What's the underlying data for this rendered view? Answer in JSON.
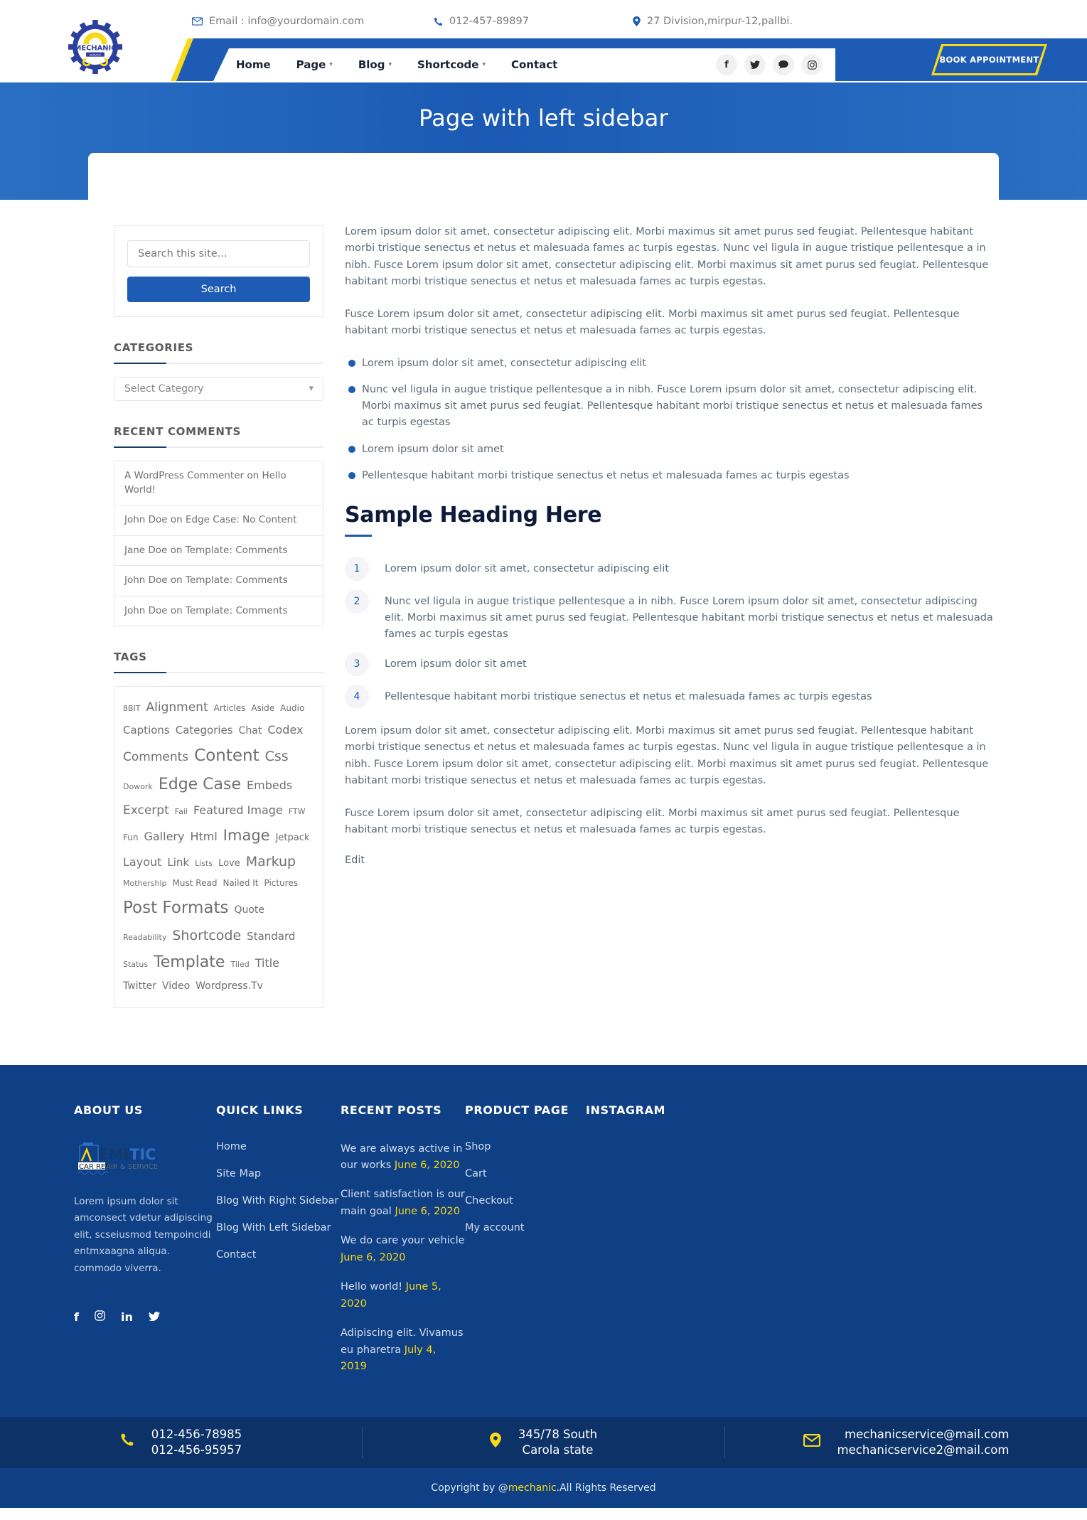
{
  "topbar": {
    "email": "Email : info@yourdomain.com",
    "phone": "012-457-89897",
    "address": "27 Division,mirpur-12,pallbi.",
    "email_icon": "envelope-icon",
    "phone_icon": "phone-icon",
    "address_icon": "map-pin-icon"
  },
  "logo": {
    "name": "MECHANIC",
    "sub": "SERVICE"
  },
  "nav": {
    "items": [
      {
        "label": "Home",
        "caret": false
      },
      {
        "label": "Page",
        "caret": true
      },
      {
        "label": "Blog",
        "caret": true
      },
      {
        "label": "Shortcode",
        "caret": true
      },
      {
        "label": "Contact",
        "caret": false
      }
    ],
    "social": [
      "facebook-icon",
      "twitter-icon",
      "comment-icon",
      "instagram-icon"
    ],
    "social_glyphs": [
      "f",
      "🐦",
      "💬",
      "▣"
    ],
    "book_button": "BOOK APPOINTMENT"
  },
  "banner": {
    "title": "Page with left sidebar"
  },
  "sidebar": {
    "search": {
      "placeholder": "Search this site...",
      "value": "",
      "button": "Search"
    },
    "categories": {
      "title": "CATEGORIES",
      "selected": "Select Category"
    },
    "recent_comments": {
      "title": "RECENT COMMENTS",
      "items": [
        "A WordPress Commenter on Hello World!",
        "John Doe on Edge Case: No Content",
        "Jane Doe on Template: Comments",
        "John Doe on Template: Comments",
        "John Doe on Template: Comments"
      ]
    },
    "tags": {
      "title": "TAGS",
      "items": [
        {
          "label": "8BIT",
          "size": 11
        },
        {
          "label": "Alignment",
          "size": 17
        },
        {
          "label": "Articles",
          "size": 12
        },
        {
          "label": "Aside",
          "size": 12
        },
        {
          "label": "Audio",
          "size": 12
        },
        {
          "label": "Captions",
          "size": 15
        },
        {
          "label": "Categories",
          "size": 15
        },
        {
          "label": "Chat",
          "size": 14
        },
        {
          "label": "Codex",
          "size": 16
        },
        {
          "label": "Comments",
          "size": 17
        },
        {
          "label": "Content",
          "size": 23
        },
        {
          "label": "Css",
          "size": 19
        },
        {
          "label": "Dowork",
          "size": 11
        },
        {
          "label": "Edge Case",
          "size": 22
        },
        {
          "label": "Embeds",
          "size": 16
        },
        {
          "label": "Excerpt",
          "size": 17
        },
        {
          "label": "Fail",
          "size": 11
        },
        {
          "label": "Featured Image",
          "size": 16
        },
        {
          "label": "FTW",
          "size": 11
        },
        {
          "label": "Fun",
          "size": 12
        },
        {
          "label": "Gallery",
          "size": 16
        },
        {
          "label": "Html",
          "size": 16
        },
        {
          "label": "Image",
          "size": 21
        },
        {
          "label": "Jetpack",
          "size": 13
        },
        {
          "label": "Layout",
          "size": 16
        },
        {
          "label": "Link",
          "size": 15
        },
        {
          "label": "Lists",
          "size": 11
        },
        {
          "label": "Love",
          "size": 13
        },
        {
          "label": "Markup",
          "size": 19
        },
        {
          "label": "Mothership",
          "size": 11
        },
        {
          "label": "Must Read",
          "size": 12
        },
        {
          "label": "Nailed It",
          "size": 12
        },
        {
          "label": "Pictures",
          "size": 12
        },
        {
          "label": "Post Formats",
          "size": 23
        },
        {
          "label": "Quote",
          "size": 14
        },
        {
          "label": "Readability",
          "size": 11
        },
        {
          "label": "Shortcode",
          "size": 19
        },
        {
          "label": "Standard",
          "size": 15
        },
        {
          "label": "Status",
          "size": 11
        },
        {
          "label": "Template",
          "size": 22
        },
        {
          "label": "Tiled",
          "size": 11
        },
        {
          "label": "Title",
          "size": 16
        },
        {
          "label": "Twitter",
          "size": 14
        },
        {
          "label": "Video",
          "size": 14
        },
        {
          "label": "Wordpress.Tv",
          "size": 14
        }
      ]
    }
  },
  "content": {
    "paragraph1": "Lorem ipsum dolor sit amet, consectetur adipiscing elit. Morbi maximus sit amet purus sed feugiat. Pellentesque habitant morbi tristique senectus et netus et malesuada fames ac turpis egestas. Nunc vel ligula in augue tristique pellentesque a in nibh. Fusce Lorem ipsum dolor sit amet, consectetur adipiscing elit. Morbi maximus sit amet purus sed feugiat. Pellentesque habitant morbi tristique senectus et netus et malesuada fames ac turpis egestas.",
    "paragraph2": "Fusce Lorem ipsum dolor sit amet, consectetur adipiscing elit. Morbi maximus sit amet purus sed feugiat. Pellentesque habitant morbi tristique senectus et netus et malesuada fames ac turpis egestas.",
    "bullets": [
      "Lorem ipsum dolor sit amet, consectetur adipiscing elit",
      "Nunc vel ligula in augue tristique pellentesque a in nibh. Fusce Lorem ipsum dolor sit amet, consectetur adipiscing elit. Morbi maximus sit amet purus sed feugiat. Pellentesque habitant morbi tristique senectus et netus et malesuada fames ac turpis egestas",
      "Lorem ipsum dolor sit amet",
      "Pellentesque habitant morbi tristique senectus et netus et malesuada fames ac turpis egestas"
    ],
    "heading": "Sample Heading Here",
    "numbered": [
      {
        "n": "1",
        "text": "Lorem ipsum dolor sit amet, consectetur adipiscing elit"
      },
      {
        "n": "2",
        "text": "Nunc vel ligula in augue tristique pellentesque a in nibh. Fusce Lorem ipsum dolor sit amet, consectetur adipiscing elit. Morbi maximus sit amet purus sed feugiat. Pellentesque habitant morbi tristique senectus et netus et malesuada fames ac turpis egestas"
      },
      {
        "n": "3",
        "text": "Lorem ipsum dolor sit amet"
      },
      {
        "n": "4",
        "text": "Pellentesque habitant morbi tristique senectus et netus et malesuada fames ac turpis egestas"
      }
    ],
    "paragraph3": "Lorem ipsum dolor sit amet, consectetur adipiscing elit. Morbi maximus sit amet purus sed feugiat. Pellentesque habitant morbi tristique senectus et netus et malesuada fames ac turpis egestas. Nunc vel ligula in augue tristique pellentesque a in nibh. Fusce Lorem ipsum dolor sit amet, consectetur adipiscing elit. Morbi maximus sit amet purus sed feugiat. Pellentesque habitant morbi tristique senectus et netus et malesuada fames ac turpis egestas.",
    "paragraph4": "Fusce Lorem ipsum dolor sit amet, consectetur adipiscing elit. Morbi maximus sit amet purus sed feugiat. Pellentesque habitant morbi tristique senectus et netus et malesuada fames ac turpis egestas.",
    "edit": "Edit"
  },
  "footer": {
    "about": {
      "title": "ABOUT US",
      "logo_main": "EMETIC",
      "logo_sub": "CAR REPAIR & SERVICE",
      "text": "Lorem ipsum dolor sit amconsect vdetur adipiscing elit, scseiusmod tempoincidi entmxaagna aliqua. commodo viverra.",
      "social": [
        "facebook-icon",
        "instagram-icon",
        "linkedin-icon",
        "twitter-icon"
      ]
    },
    "quick_links": {
      "title": "QUICK LINKS",
      "items": [
        "Home",
        "Site Map",
        "Blog With Right Sidebar",
        "Blog With Left Sidebar",
        "Contact"
      ]
    },
    "recent_posts": {
      "title": "RECENT POSTS",
      "items": [
        {
          "text": "We are always active in our works",
          "date": "June 6, 2020"
        },
        {
          "text": "Client satisfaction is our main goal",
          "date": "June 6, 2020"
        },
        {
          "text": "We do care your vehicle",
          "date": "June 6, 2020"
        },
        {
          "text": "Hello world!",
          "date": "June 5, 2020"
        },
        {
          "text": "Adipiscing elit. Vivamus eu pharetra",
          "date": "July 4, 2019"
        }
      ]
    },
    "product_page": {
      "title": "PRODUCT PAGE",
      "items": [
        "Shop",
        "Cart",
        "Checkout",
        "My account"
      ]
    },
    "instagram": {
      "title": "INSTAGRAM"
    },
    "contact_bar": {
      "phones": [
        "012-456-78985",
        "012-456-95957"
      ],
      "address": [
        "345/78 South",
        "Carola state"
      ],
      "emails": [
        "mechanicservice@mail.com",
        "mechanicservice2@mail.com"
      ],
      "phone_icon": "phone-icon",
      "location_icon": "map-pin-icon",
      "mail_icon": "envelope-icon"
    },
    "copyright_prefix": "Copyright by @",
    "copyright_brand": "mechanic",
    "copyright_suffix": ".All Rights Reserved"
  },
  "colors": {
    "brand_blue": "#1d5bb5",
    "brand_yellow": "#f7d917",
    "footer_blue": "#0f3f84",
    "dark_blue": "#0c3268"
  }
}
